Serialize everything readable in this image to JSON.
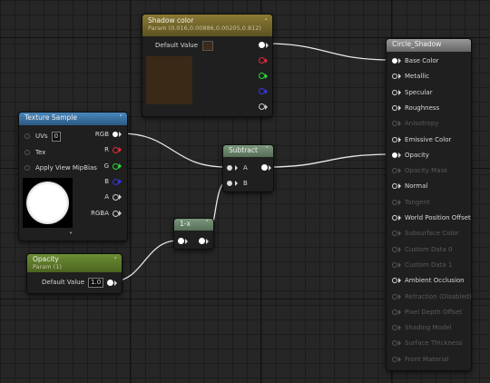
{
  "shadow_color_node": {
    "title": "Shadow color",
    "subtitle": "Param (0.016,0.00886,0.00205,0.812)",
    "default_label": "Default Value",
    "swatch_color": "#3b2b18",
    "preview_color": "#3a2917",
    "header_color": "#7a6a2c",
    "output_pins": [
      "white",
      "red",
      "green",
      "blue",
      "alpha"
    ]
  },
  "texture_sample_node": {
    "title": "Texture Sample",
    "header_color": "#3a6e9c",
    "inputs": [
      {
        "label": "UVs",
        "value": "0"
      },
      {
        "label": "Tex"
      },
      {
        "label": "Apply View MipBias"
      }
    ],
    "outputs": [
      "RGB",
      "R",
      "G",
      "B",
      "A",
      "RGBA"
    ],
    "expand_icon": "chevron-down"
  },
  "subtract_node": {
    "title": "Subtract",
    "header_color": "#657f66",
    "inputs": [
      "A",
      "B"
    ]
  },
  "one_minus_node": {
    "title": "1-x",
    "header_color": "#657f66"
  },
  "opacity_node": {
    "title": "Opacity",
    "subtitle": "Param (1)",
    "header_color": "#5c7a2c",
    "default_label": "Default Value",
    "default_value": "1.0"
  },
  "material_node": {
    "title": "Circle_Shadow",
    "header_color": "#7d7d7d",
    "pins": [
      {
        "label": "Base Color",
        "state": "connected"
      },
      {
        "label": "Metallic",
        "state": "active"
      },
      {
        "label": "Specular",
        "state": "active"
      },
      {
        "label": "Roughness",
        "state": "active"
      },
      {
        "label": "Anisotropy",
        "state": "disabled"
      },
      {
        "label": "Emissive Color",
        "state": "active"
      },
      {
        "label": "Opacity",
        "state": "connected"
      },
      {
        "label": "Opacity Mask",
        "state": "disabled"
      },
      {
        "label": "Normal",
        "state": "active"
      },
      {
        "label": "Tangent",
        "state": "disabled"
      },
      {
        "label": "World Position Offset",
        "state": "active"
      },
      {
        "label": "Subsurface Color",
        "state": "disabled"
      },
      {
        "label": "Custom Data 0",
        "state": "disabled"
      },
      {
        "label": "Custom Data 1",
        "state": "disabled"
      },
      {
        "label": "Ambient Occlusion",
        "state": "active"
      },
      {
        "label": "Refraction (Disabled)",
        "state": "disabled"
      },
      {
        "label": "Pixel Depth Offset",
        "state": "disabled"
      },
      {
        "label": "Shading Model",
        "state": "disabled"
      },
      {
        "label": "Surface Thickness",
        "state": "disabled"
      },
      {
        "label": "Front Material",
        "state": "disabled"
      }
    ]
  }
}
